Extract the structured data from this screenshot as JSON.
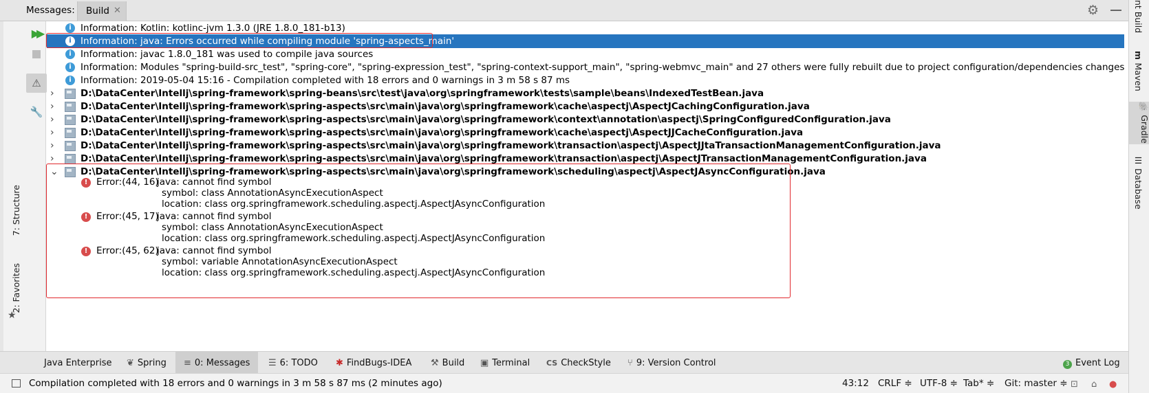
{
  "header": {
    "label": "Messages:",
    "tab": "Build",
    "tab_close": "✕"
  },
  "left_sidebar": {
    "structure": "7: Structure",
    "favorites": "2: Favorites"
  },
  "right_sidebar": {
    "ant_build": "nt Build",
    "maven": "Maven",
    "gradle": "Gradle",
    "database": "Database"
  },
  "info_rows": [
    "Information: Kotlin: kotlinc-jvm 1.3.0 (JRE 1.8.0_181-b13)",
    "Information: java: Errors occurred while compiling module 'spring-aspects_main'",
    "Information: javac 1.8.0_181 was used to compile java sources",
    "Information: Modules \"spring-build-src_test\", \"spring-core\", \"spring-expression_test\", \"spring-context-support_main\", \"spring-webmvc_main\" and 27 others were fully rebuilt due to project configuration/dependencies changes",
    "Information: 2019-05-04 15:16 - Compilation completed with 18 errors and 0 warnings in 3 m 58 s 87 ms"
  ],
  "file_rows": [
    "D:\\DataCenter\\Intellj\\spring-framework\\spring-beans\\src\\test\\java\\org\\springframework\\tests\\sample\\beans\\IndexedTestBean.java",
    "D:\\DataCenter\\Intellj\\spring-framework\\spring-aspects\\src\\main\\java\\org\\springframework\\cache\\aspectj\\AspectJCachingConfiguration.java",
    "D:\\DataCenter\\Intellj\\spring-framework\\spring-aspects\\src\\main\\java\\org\\springframework\\context\\annotation\\aspectj\\SpringConfiguredConfiguration.java",
    "D:\\DataCenter\\Intellj\\spring-framework\\spring-aspects\\src\\main\\java\\org\\springframework\\cache\\aspectj\\AspectJJCacheConfiguration.java",
    "D:\\DataCenter\\Intellj\\spring-framework\\spring-aspects\\src\\main\\java\\org\\springframework\\transaction\\aspectj\\AspectJJtaTransactionManagementConfiguration.java",
    "D:\\DataCenter\\Intellj\\spring-framework\\spring-aspects\\src\\main\\java\\org\\springframework\\transaction\\aspectj\\AspectJTransactionManagementConfiguration.java",
    "D:\\DataCenter\\Intellj\\spring-framework\\spring-aspects\\src\\main\\java\\org\\springframework\\scheduling\\aspectj\\AspectJAsyncConfiguration.java"
  ],
  "errors": [
    {
      "pos": "Error:(44, 16)",
      "msg": "java: cannot find symbol",
      "symbol": "symbol:   class AnnotationAsyncExecutionAspect",
      "location": "location: class org.springframework.scheduling.aspectj.AspectJAsyncConfiguration"
    },
    {
      "pos": "Error:(45, 17)",
      "msg": "java: cannot find symbol",
      "symbol": "symbol:   class AnnotationAsyncExecutionAspect",
      "location": "location: class org.springframework.scheduling.aspectj.AspectJAsyncConfiguration"
    },
    {
      "pos": "Error:(45, 62)",
      "msg": "java: cannot find symbol",
      "symbol": "symbol:   variable AnnotationAsyncExecutionAspect",
      "location": "location: class org.springframework.scheduling.aspectj.AspectJAsyncConfiguration"
    }
  ],
  "bottom_tabs": {
    "java_enterprise": "Java Enterprise",
    "spring": "Spring",
    "messages": "0: Messages",
    "todo": "6: TODO",
    "findbugs": "FindBugs-IDEA",
    "build": "Build",
    "terminal": "Terminal",
    "checkstyle": "CheckStyle",
    "version_control": "9: Version Control",
    "event_log": "Event Log",
    "event_log_count": "3"
  },
  "status": {
    "message": "Compilation completed with 18 errors and 0 warnings in 3 m 58 s 87 ms (2 minutes ago)",
    "position": "43:12",
    "line_sep": "CRLF ≑",
    "encoding": "UTF-8 ≑",
    "indent": "Tab* ≑",
    "vcs": "Git: master ≑"
  },
  "colors": {
    "selection": "#2675bf",
    "error": "#d84c4c",
    "info": "#3e9bd8",
    "highlight_box": "#e0282d"
  }
}
